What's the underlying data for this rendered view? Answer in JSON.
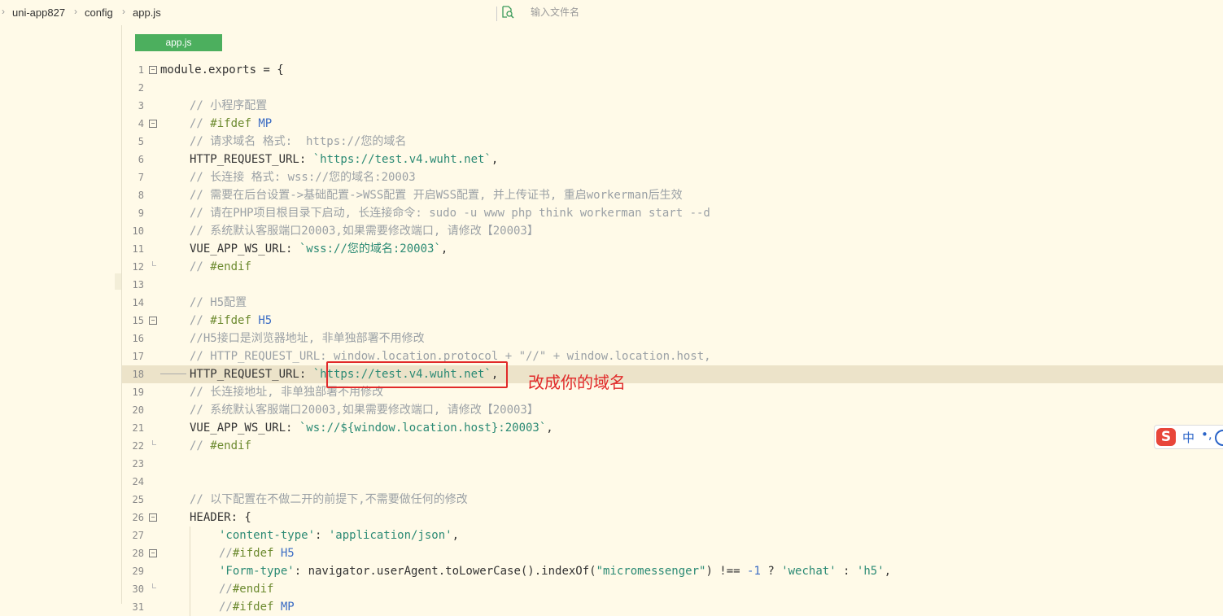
{
  "breadcrumb": {
    "items": [
      "uni-app827",
      "config",
      "app.js"
    ]
  },
  "search": {
    "placeholder": "输入文件名"
  },
  "editor": {
    "tab_label": "app.js",
    "highlighted_line": 18
  },
  "annotation": {
    "text": "改成你的域名"
  },
  "ime": {
    "zh": "中",
    "punct": "•,"
  },
  "lines": [
    {
      "n": "1",
      "fold": "open",
      "indent": 0,
      "t": [
        [
          "p",
          "module.exports = {"
        ]
      ]
    },
    {
      "n": "2",
      "indent": 0,
      "t": []
    },
    {
      "n": "3",
      "indent": 1,
      "t": [
        [
          "c",
          "// 小程序配置"
        ]
      ]
    },
    {
      "n": "4",
      "fold": "open",
      "indent": 1,
      "t": [
        [
          "c",
          "// "
        ],
        [
          "d",
          "#ifdef"
        ],
        [
          "c",
          " "
        ],
        [
          "k",
          "MP"
        ]
      ]
    },
    {
      "n": "5",
      "indent": 1,
      "t": [
        [
          "c",
          "// 请求域名 格式:  https://您的域名"
        ]
      ]
    },
    {
      "n": "6",
      "indent": 1,
      "t": [
        [
          "p",
          "HTTP_REQUEST_URL: "
        ],
        [
          "s",
          "`https://test.v4.wuht.net`"
        ],
        [
          "p",
          ","
        ]
      ]
    },
    {
      "n": "7",
      "indent": 1,
      "t": [
        [
          "c",
          "// 长连接 格式: wss://您的域名:20003"
        ]
      ]
    },
    {
      "n": "8",
      "indent": 1,
      "t": [
        [
          "c",
          "// 需要在后台设置->基础配置->WSS配置 开启WSS配置, 并上传证书, 重启workerman后生效"
        ]
      ]
    },
    {
      "n": "9",
      "indent": 1,
      "t": [
        [
          "c",
          "// 请在PHP项目根目录下启动, 长连接命令: sudo -u www php think workerman start --d"
        ]
      ]
    },
    {
      "n": "10",
      "indent": 1,
      "t": [
        [
          "c",
          "// 系统默认客服端口20003,如果需要修改端口, 请修改【20003】"
        ]
      ]
    },
    {
      "n": "11",
      "indent": 1,
      "t": [
        [
          "p",
          "VUE_APP_WS_URL: "
        ],
        [
          "s",
          "`wss://您的域名:20003`"
        ],
        [
          "p",
          ","
        ]
      ]
    },
    {
      "n": "12",
      "fold": "end",
      "indent": 1,
      "t": [
        [
          "c",
          "// "
        ],
        [
          "d",
          "#endif"
        ]
      ]
    },
    {
      "n": "13",
      "indent": 0,
      "t": []
    },
    {
      "n": "14",
      "indent": 1,
      "t": [
        [
          "c",
          "// H5配置"
        ]
      ]
    },
    {
      "n": "15",
      "fold": "open",
      "indent": 1,
      "t": [
        [
          "c",
          "// "
        ],
        [
          "d",
          "#ifdef"
        ],
        [
          "c",
          " "
        ],
        [
          "k",
          "H5"
        ]
      ]
    },
    {
      "n": "16",
      "indent": 1,
      "t": [
        [
          "c",
          "//H5接口是浏览器地址, 非单独部署不用修改"
        ]
      ]
    },
    {
      "n": "17",
      "indent": 1,
      "t": [
        [
          "c",
          "// HTTP_REQUEST_URL: window.location.protocol + \"//\" + window.location.host,"
        ]
      ]
    },
    {
      "n": "18",
      "indent": 1,
      "hl": true,
      "t": [
        [
          "p",
          "HTTP_REQUEST_URL: "
        ],
        [
          "s",
          "`https://test.v4.wuht.net`"
        ],
        [
          "p",
          ","
        ]
      ]
    },
    {
      "n": "19",
      "indent": 1,
      "t": [
        [
          "c",
          "// 长连接地址, 非单独部署不用修改"
        ]
      ]
    },
    {
      "n": "20",
      "indent": 1,
      "t": [
        [
          "c",
          "// 系统默认客服端口20003,如果需要修改端口, 请修改【20003】"
        ]
      ]
    },
    {
      "n": "21",
      "indent": 1,
      "t": [
        [
          "p",
          "VUE_APP_WS_URL: "
        ],
        [
          "s",
          "`ws://${window.location.host}:20003`"
        ],
        [
          "p",
          ","
        ]
      ]
    },
    {
      "n": "22",
      "fold": "end",
      "indent": 1,
      "t": [
        [
          "c",
          "// "
        ],
        [
          "d",
          "#endif"
        ]
      ]
    },
    {
      "n": "23",
      "indent": 0,
      "t": []
    },
    {
      "n": "24",
      "indent": 0,
      "t": []
    },
    {
      "n": "25",
      "indent": 1,
      "t": [
        [
          "c",
          "// 以下配置在不做二开的前提下,不需要做任何的修改"
        ]
      ]
    },
    {
      "n": "26",
      "fold": "open",
      "indent": 1,
      "t": [
        [
          "p",
          "HEADER: {"
        ]
      ]
    },
    {
      "n": "27",
      "indent": 2,
      "t": [
        [
          "s",
          "'content-type'"
        ],
        [
          "p",
          ": "
        ],
        [
          "s",
          "'application/json'"
        ],
        [
          "p",
          ","
        ]
      ]
    },
    {
      "n": "28",
      "fold": "open",
      "indent": 2,
      "t": [
        [
          "c",
          "//"
        ],
        [
          "d",
          "#ifdef"
        ],
        [
          "c",
          " "
        ],
        [
          "k",
          "H5"
        ]
      ]
    },
    {
      "n": "29",
      "indent": 2,
      "t": [
        [
          "s",
          "'Form-type'"
        ],
        [
          "p",
          ": navigator.userAgent.toLowerCase().indexOf("
        ],
        [
          "s",
          "\"micromessenger\""
        ],
        [
          "p",
          ") !== "
        ],
        [
          "k",
          "-1"
        ],
        [
          "p",
          " ? "
        ],
        [
          "s",
          "'wechat'"
        ],
        [
          "p",
          " : "
        ],
        [
          "s",
          "'h5'"
        ],
        [
          "p",
          ","
        ]
      ]
    },
    {
      "n": "30",
      "fold": "end",
      "indent": 2,
      "t": [
        [
          "c",
          "//"
        ],
        [
          "d",
          "#endif"
        ]
      ]
    },
    {
      "n": "31",
      "indent": 2,
      "t": [
        [
          "c",
          "//"
        ],
        [
          "d",
          "#ifdef"
        ],
        [
          "c",
          " "
        ],
        [
          "k",
          "MP"
        ]
      ]
    }
  ]
}
